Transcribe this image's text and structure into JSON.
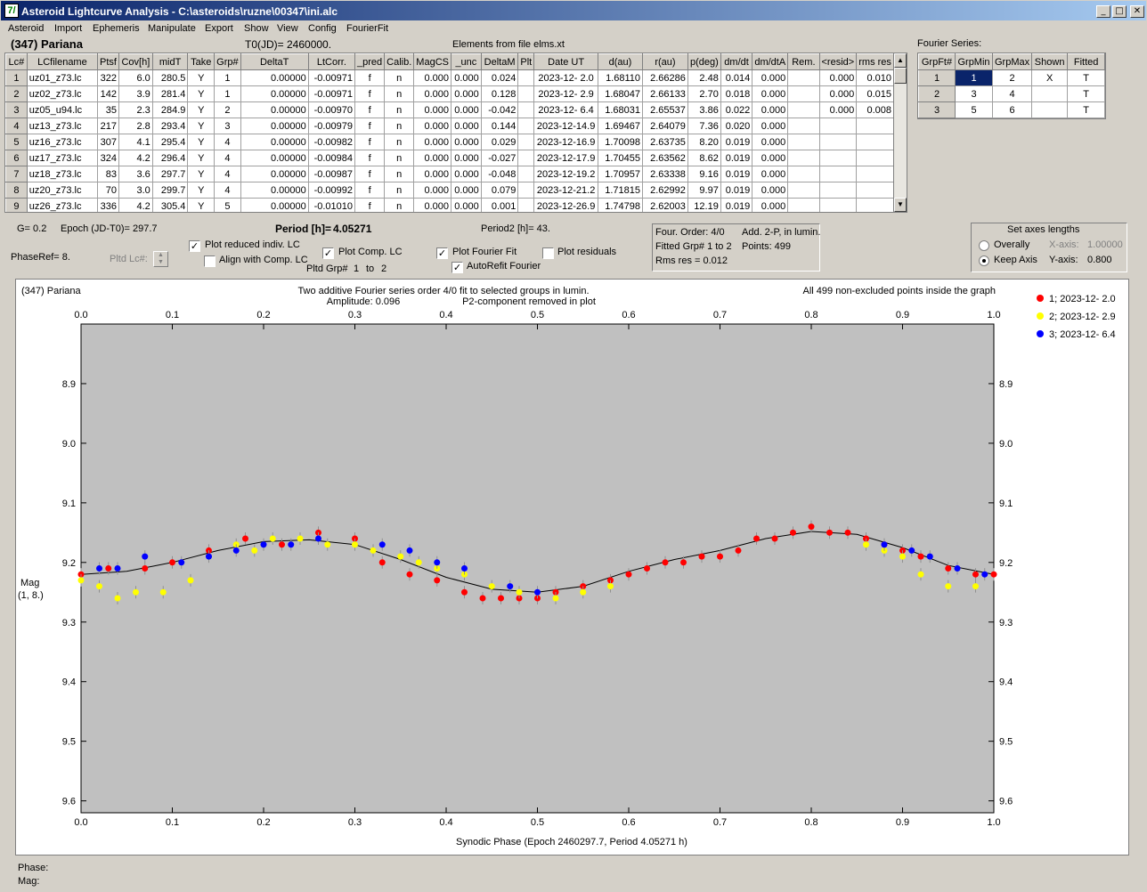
{
  "window": {
    "title": "Asteroid Lightcurve Analysis - C:\\asteroids\\ruzne\\00347\\ini.alc",
    "icon_glyph": "7/",
    "min": "_",
    "max": "□",
    "close": "✕"
  },
  "menu": [
    "Asteroid",
    "Import",
    "Ephemeris",
    "Manipulate",
    "Export",
    "Show",
    "View",
    "Config",
    "FourierFit"
  ],
  "header": {
    "asteroid": "(347) Pariana",
    "t0": "T0(JD)= 2460000.",
    "elements": "Elements from file elms.xt"
  },
  "lc_table": {
    "columns": [
      "Lc#",
      "LCfilename",
      "Ptsf",
      "Cov[h]",
      "midT",
      "Take",
      "Grp#",
      "DeltaT",
      "LtCorr.",
      "_pred",
      "Calib.",
      "MagCS",
      "_unc",
      "DeltaM",
      "Plt",
      "Date UT",
      "d(au)",
      "r(au)",
      "p(deg)",
      "dm/dt",
      "dm/dtA",
      "Rem.",
      "<resid>",
      "rms res"
    ],
    "rows": [
      [
        "1",
        "uz01_z73.lc",
        "322",
        "6.0",
        "280.5",
        "Y",
        "1",
        "0.00000",
        "-0.00971",
        "f",
        "n",
        "0.000",
        "0.000",
        "0.024",
        "",
        "2023-12- 2.0",
        "1.68110",
        "2.66286",
        "2.48",
        "0.014",
        "0.000",
        "",
        "0.000",
        "0.010"
      ],
      [
        "2",
        "uz02_z73.lc",
        "142",
        "3.9",
        "281.4",
        "Y",
        "1",
        "0.00000",
        "-0.00971",
        "f",
        "n",
        "0.000",
        "0.000",
        "0.128",
        "",
        "2023-12- 2.9",
        "1.68047",
        "2.66133",
        "2.70",
        "0.018",
        "0.000",
        "",
        "0.000",
        "0.015"
      ],
      [
        "3",
        "uz05_u94.lc",
        "35",
        "2.3",
        "284.9",
        "Y",
        "2",
        "0.00000",
        "-0.00970",
        "f",
        "n",
        "0.000",
        "0.000",
        "-0.042",
        "",
        "2023-12- 6.4",
        "1.68031",
        "2.65537",
        "3.86",
        "0.022",
        "0.000",
        "",
        "0.000",
        "0.008"
      ],
      [
        "4",
        "uz13_z73.lc",
        "217",
        "2.8",
        "293.4",
        "Y",
        "3",
        "0.00000",
        "-0.00979",
        "f",
        "n",
        "0.000",
        "0.000",
        "0.144",
        "",
        "2023-12-14.9",
        "1.69467",
        "2.64079",
        "7.36",
        "0.020",
        "0.000",
        "",
        "",
        ""
      ],
      [
        "5",
        "uz16_z73.lc",
        "307",
        "4.1",
        "295.4",
        "Y",
        "4",
        "0.00000",
        "-0.00982",
        "f",
        "n",
        "0.000",
        "0.000",
        "0.029",
        "",
        "2023-12-16.9",
        "1.70098",
        "2.63735",
        "8.20",
        "0.019",
        "0.000",
        "",
        "",
        ""
      ],
      [
        "6",
        "uz17_z73.lc",
        "324",
        "4.2",
        "296.4",
        "Y",
        "4",
        "0.00000",
        "-0.00984",
        "f",
        "n",
        "0.000",
        "0.000",
        "-0.027",
        "",
        "2023-12-17.9",
        "1.70455",
        "2.63562",
        "8.62",
        "0.019",
        "0.000",
        "",
        "",
        ""
      ],
      [
        "7",
        "uz18_z73.lc",
        "83",
        "3.6",
        "297.7",
        "Y",
        "4",
        "0.00000",
        "-0.00987",
        "f",
        "n",
        "0.000",
        "0.000",
        "-0.048",
        "",
        "2023-12-19.2",
        "1.70957",
        "2.63338",
        "9.16",
        "0.019",
        "0.000",
        "",
        "",
        ""
      ],
      [
        "8",
        "uz20_z73.lc",
        "70",
        "3.0",
        "299.7",
        "Y",
        "4",
        "0.00000",
        "-0.00992",
        "f",
        "n",
        "0.000",
        "0.000",
        "0.079",
        "",
        "2023-12-21.2",
        "1.71815",
        "2.62992",
        "9.97",
        "0.019",
        "0.000",
        "",
        "",
        ""
      ],
      [
        "9",
        "uz26_z73.lc",
        "336",
        "4.2",
        "305.4",
        "Y",
        "5",
        "0.00000",
        "-0.01010",
        "f",
        "n",
        "0.000",
        "0.000",
        "0.001",
        "",
        "2023-12-26.9",
        "1.74798",
        "2.62003",
        "12.19",
        "0.019",
        "0.000",
        "",
        "",
        ""
      ]
    ]
  },
  "fourier_table": {
    "label": "Fourier Series:",
    "columns": [
      "GrpFt#",
      "GrpMin",
      "GrpMax",
      "Shown",
      "Fitted"
    ],
    "rows": [
      [
        "1",
        "1",
        "2",
        "X",
        "T"
      ],
      [
        "2",
        "3",
        "4",
        "",
        "T"
      ],
      [
        "3",
        "5",
        "6",
        "",
        "T"
      ]
    ]
  },
  "params": {
    "g": "G= 0.2",
    "epoch": "Epoch (JD-T0)= 297.7",
    "period_label": "Period [h]=",
    "period": "4.05271",
    "period2": "Period2 [h]= 43.",
    "phaseref": "PhaseRef= 8.",
    "pltd_lc": "Pltd Lc#:",
    "pltd_grp_a": "Pltd Grp#",
    "pltd_grp_from": "1",
    "pltd_grp_to_label": "to",
    "pltd_grp_to": "2"
  },
  "checkboxes": {
    "plot_reduced": {
      "label": "Plot reduced indiv. LC",
      "checked": true
    },
    "align_comp": {
      "label": "Align with Comp. LC",
      "checked": false
    },
    "plot_comp": {
      "label": "Plot Comp. LC",
      "checked": true
    },
    "plot_fourier": {
      "label": "Plot Fourier Fit",
      "checked": true
    },
    "autorefit": {
      "label": "AutoRefit Fourier",
      "checked": true
    },
    "plot_residuals": {
      "label": "Plot residuals",
      "checked": false
    }
  },
  "fit_info": {
    "order": "Four. Order:  4/0",
    "add": "Add. 2-P, in lumin.",
    "fitted": "Fitted Grp# 1 to 2",
    "points": "Points: 499",
    "rms": "Rms res     = 0.012"
  },
  "axes_box": {
    "title": "Set axes lengths",
    "overally": "Overally",
    "keep": "Keep Axis",
    "x_label": "X-axis:",
    "x_val": "1.00000",
    "y_label": "Y-axis:",
    "y_val": "0.800",
    "selected": "keep"
  },
  "plot": {
    "top_left": "(347) Pariana",
    "title1": "Two additive Fourier series order 4/0 fit to selected groups in lumin.",
    "amplitude": "Amplitude: 0.096",
    "p2": "P2-component removed in plot",
    "top_right": "All 499 non-excluded points inside the graph",
    "ylabel1": "Mag",
    "ylabel2": "(1, 8.)",
    "xlabel": "Synodic Phase (Epoch 2460297.7, Period 4.05271 h)",
    "legend": [
      {
        "label": "1; 2023-12- 2.0",
        "color": "#ff0000"
      },
      {
        "label": "2; 2023-12- 2.9",
        "color": "#ffff00"
      },
      {
        "label": "3; 2023-12- 6.4",
        "color": "#0000ff"
      }
    ]
  },
  "chart_data": {
    "type": "scatter",
    "xlim": [
      0.0,
      1.0
    ],
    "ylim": [
      8.8,
      9.62
    ],
    "y_inverted": true,
    "xticks": [
      "0.0",
      "0.1",
      "0.2",
      "0.3",
      "0.4",
      "0.5",
      "0.6",
      "0.7",
      "0.8",
      "0.9",
      "1.0"
    ],
    "yticks": [
      "8.9",
      "9.0",
      "9.1",
      "9.2",
      "9.3",
      "9.4",
      "9.5",
      "9.6"
    ],
    "grid": false,
    "fit_curve": {
      "color": "#000000",
      "x": [
        0.0,
        0.05,
        0.1,
        0.15,
        0.2,
        0.25,
        0.3,
        0.35,
        0.4,
        0.45,
        0.5,
        0.55,
        0.6,
        0.65,
        0.7,
        0.75,
        0.8,
        0.85,
        0.9,
        0.95,
        1.0
      ],
      "y": [
        9.22,
        9.215,
        9.2,
        9.18,
        9.165,
        9.162,
        9.17,
        9.195,
        9.225,
        9.245,
        9.25,
        9.24,
        9.215,
        9.195,
        9.18,
        9.16,
        9.148,
        9.153,
        9.175,
        9.205,
        9.22
      ]
    },
    "series": [
      {
        "name": "1; 2023-12- 2.0",
        "color": "#ff0000",
        "x": [
          0.0,
          0.03,
          0.07,
          0.1,
          0.14,
          0.18,
          0.22,
          0.26,
          0.3,
          0.33,
          0.36,
          0.39,
          0.42,
          0.44,
          0.46,
          0.48,
          0.5,
          0.52,
          0.55,
          0.58,
          0.6,
          0.62,
          0.64,
          0.66,
          0.68,
          0.7,
          0.72,
          0.74,
          0.76,
          0.78,
          0.8,
          0.82,
          0.84,
          0.86,
          0.88,
          0.9,
          0.92,
          0.95,
          0.98,
          1.0
        ],
        "y": [
          9.22,
          9.21,
          9.21,
          9.2,
          9.18,
          9.16,
          9.17,
          9.15,
          9.16,
          9.2,
          9.22,
          9.23,
          9.25,
          9.26,
          9.26,
          9.26,
          9.26,
          9.25,
          9.24,
          9.23,
          9.22,
          9.21,
          9.2,
          9.2,
          9.19,
          9.19,
          9.18,
          9.16,
          9.16,
          9.15,
          9.14,
          9.15,
          9.15,
          9.16,
          9.17,
          9.18,
          9.19,
          9.21,
          9.22,
          9.22
        ]
      },
      {
        "name": "2; 2023-12- 2.9",
        "color": "#ffff00",
        "x": [
          0.0,
          0.02,
          0.04,
          0.06,
          0.09,
          0.12,
          0.17,
          0.19,
          0.21,
          0.24,
          0.27,
          0.3,
          0.32,
          0.35,
          0.37,
          0.39,
          0.42,
          0.45,
          0.48,
          0.52,
          0.55,
          0.58,
          0.86,
          0.88,
          0.9,
          0.92,
          0.95,
          0.98
        ],
        "y": [
          9.23,
          9.24,
          9.26,
          9.25,
          9.25,
          9.23,
          9.17,
          9.18,
          9.16,
          9.16,
          9.17,
          9.17,
          9.18,
          9.19,
          9.2,
          9.21,
          9.22,
          9.24,
          9.25,
          9.26,
          9.25,
          9.24,
          9.17,
          9.18,
          9.19,
          9.22,
          9.24,
          9.24
        ]
      },
      {
        "name": "3; 2023-12- 6.4",
        "color": "#0000ff",
        "x": [
          0.02,
          0.04,
          0.07,
          0.11,
          0.14,
          0.17,
          0.2,
          0.23,
          0.26,
          0.33,
          0.36,
          0.39,
          0.42,
          0.47,
          0.5,
          0.88,
          0.91,
          0.93,
          0.96,
          0.99
        ],
        "y": [
          9.21,
          9.21,
          9.19,
          9.2,
          9.19,
          9.18,
          9.17,
          9.17,
          9.16,
          9.17,
          9.18,
          9.2,
          9.21,
          9.24,
          9.25,
          9.17,
          9.18,
          9.19,
          9.21,
          9.22
        ]
      }
    ]
  },
  "status": {
    "phase": "Phase:",
    "mag": "Mag:"
  }
}
